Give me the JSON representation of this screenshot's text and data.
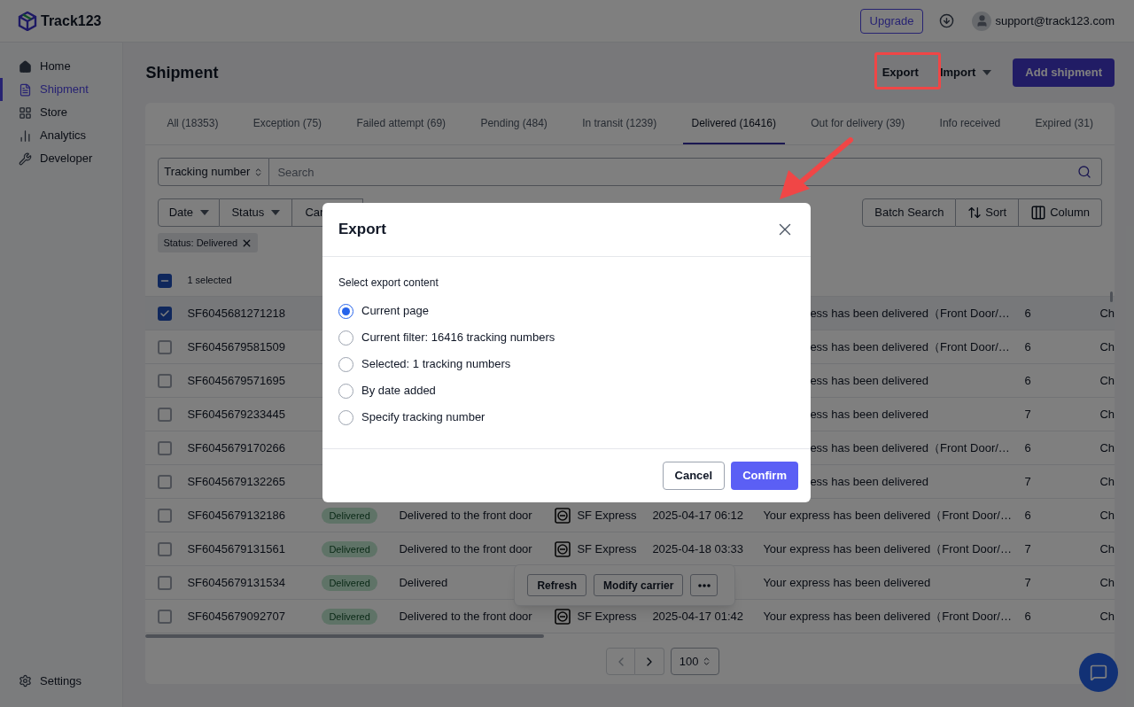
{
  "header": {
    "logo_text": "Track123",
    "upgrade": "Upgrade",
    "account": "support@track123.com"
  },
  "sidebar": {
    "items": [
      {
        "label": "Home",
        "selected": false
      },
      {
        "label": "Shipment",
        "selected": true
      },
      {
        "label": "Store",
        "selected": false
      },
      {
        "label": "Analytics",
        "selected": false
      },
      {
        "label": "Developer",
        "selected": false
      }
    ],
    "settings": "Settings"
  },
  "page": {
    "title": "Shipment",
    "export": "Export",
    "import": "Import",
    "add": "Add shipment"
  },
  "tabs": [
    {
      "label": "All (18353)",
      "selected": false
    },
    {
      "label": "Exception (75)",
      "selected": false
    },
    {
      "label": "Failed attempt (69)",
      "selected": false
    },
    {
      "label": "Pending (484)",
      "selected": false
    },
    {
      "label": "In transit (1239)",
      "selected": false
    },
    {
      "label": "Delivered (16416)",
      "selected": true
    },
    {
      "label": "Out for delivery (39)",
      "selected": false
    },
    {
      "label": "Info received",
      "selected": false
    },
    {
      "label": "Expired (31)",
      "selected": false
    }
  ],
  "search": {
    "field": "Tracking number",
    "placeholder": "Search"
  },
  "filters": [
    "Date",
    "Status",
    "Car"
  ],
  "tools": [
    "Batch Search",
    "Sort",
    "Column"
  ],
  "active_filters": [
    "Status: Delivered"
  ],
  "table": {
    "selection_label": "1 selected",
    "indeterminate": true,
    "rows": [
      {
        "kind": "covered",
        "selected": true,
        "tracking": "SF6045681271218",
        "latest_event": "ess has been delivered（Front Door/…",
        "days": "6",
        "column_last": "Ch"
      },
      {
        "kind": "covered",
        "selected": false,
        "tracking": "SF6045679581509",
        "latest_event": "ess has been delivered（Front Door/…",
        "days": "6",
        "column_last": "Ch"
      },
      {
        "kind": "covered",
        "selected": false,
        "tracking": "SF6045679571695",
        "latest_event": "ess has been delivered",
        "days": "6",
        "column_last": "Ch"
      },
      {
        "kind": "covered",
        "selected": false,
        "tracking": "SF6045679233445",
        "latest_event": "ess has been delivered",
        "days": "7",
        "column_last": "Ch"
      },
      {
        "kind": "covered",
        "selected": false,
        "tracking": "SF6045679170266",
        "latest_event": "ess has been delivered（Front Door/…",
        "days": "6",
        "column_last": "Ch"
      },
      {
        "kind": "covered",
        "selected": false,
        "tracking": "SF6045679132265",
        "latest_event": "ess has been delivered",
        "days": "7",
        "column_last": "Ch"
      },
      {
        "kind": "full",
        "selected": false,
        "tracking": "SF6045679132186",
        "status": "Delivered",
        "description": "Delivered to the front door",
        "carrier": "SF Express",
        "date": "2025-04-17 06:12",
        "latest_event": "Your express has been delivered（Front Door/…",
        "days": "6",
        "column_last": "Ch"
      },
      {
        "kind": "full",
        "selected": false,
        "tracking": "SF6045679131561",
        "status": "Delivered",
        "description": "Delivered to the front door",
        "carrier": "SF Express",
        "date": "2025-04-18 03:33",
        "latest_event": "Your express has been delivered（Front Door/…",
        "days": "7",
        "column_last": "Ch"
      },
      {
        "kind": "full",
        "selected": false,
        "tracking": "SF6045679131534",
        "status": "Delivered",
        "description": "Delivered",
        "latest_event": "Your express has been delivered",
        "days": "7",
        "column_last": "Ch"
      },
      {
        "kind": "full",
        "selected": false,
        "tracking": "SF6045679092707",
        "status": "Delivered",
        "description": "Delivered to the front door",
        "carrier": "SF Express",
        "date": "2025-04-17 01:42",
        "latest_event": "Your express has been delivered（Front Door/…",
        "days": "6",
        "column_last": "Ch"
      }
    ]
  },
  "floating_bar": {
    "buttons": [
      "Refresh",
      "Modify carrier"
    ]
  },
  "pagination": {
    "page_size": "100"
  },
  "dialog": {
    "title": "Export",
    "prompt": "Select export content",
    "options": [
      {
        "label": "Current page",
        "selected": true
      },
      {
        "label": "Current filter: 16416 tracking numbers",
        "selected": false
      },
      {
        "label": "Selected: 1 tracking numbers",
        "selected": false
      },
      {
        "label": "By date added",
        "selected": false
      },
      {
        "label": "Specify tracking number",
        "selected": false
      }
    ],
    "cancel": "Cancel",
    "confirm": "Confirm"
  }
}
